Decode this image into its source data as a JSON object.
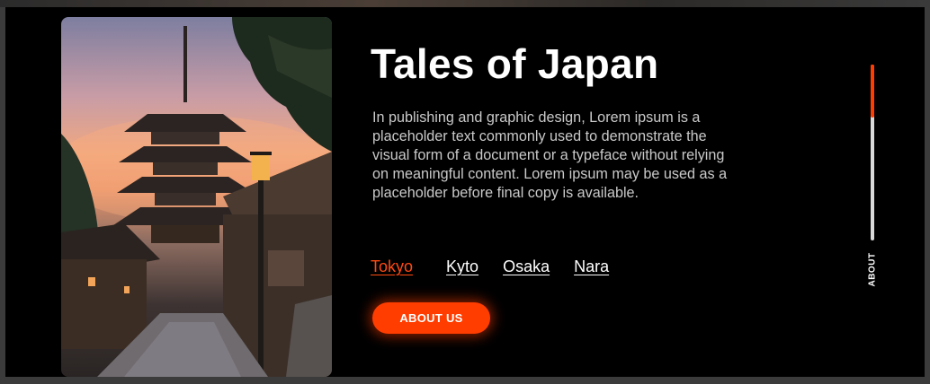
{
  "hero": {
    "title": "Tales of Japan",
    "description": "In publishing and graphic design, Lorem ipsum is a placeholder text commonly used to demonstrate the visual form of a document or a typeface without relying on meaningful content. Lorem ipsum may be used as a placeholder before final copy is available.",
    "image_icon": "pagoda-photo"
  },
  "cities": {
    "items": [
      {
        "label": "Tokyo",
        "active": true
      },
      {
        "label": "Kyto",
        "active": false
      },
      {
        "label": "Osaka",
        "active": false
      },
      {
        "label": "Nara",
        "active": false
      }
    ]
  },
  "cta": {
    "label": "ABOUT US"
  },
  "side_nav": {
    "label": "ABOUT",
    "progress": 0.3
  },
  "colors": {
    "accent": "#ff3d00",
    "background": "#000000",
    "text": "#ffffff",
    "muted_text": "#c9c9c9"
  }
}
